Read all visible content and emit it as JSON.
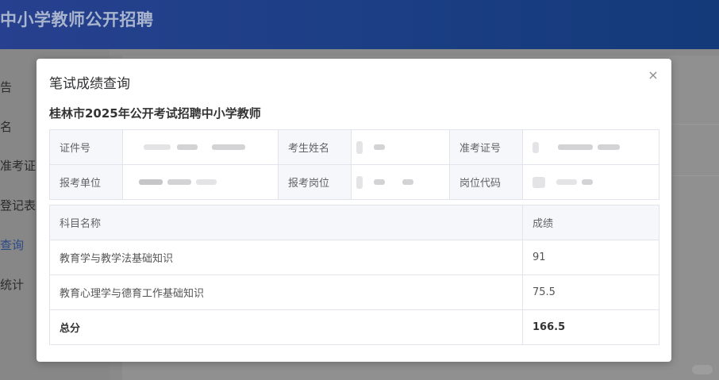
{
  "app": {
    "header_title": "中小学教师公开招聘"
  },
  "sidebar": {
    "items": [
      {
        "label": "告"
      },
      {
        "label": "名"
      },
      {
        "label": "准考证"
      },
      {
        "label": "登记表"
      },
      {
        "label": "查询"
      },
      {
        "label": "统计"
      }
    ]
  },
  "modal": {
    "title": "笔试成绩查询",
    "close_icon": "×",
    "subtitle": "桂林市2025年公开考试招聘中小学教师",
    "info_table": {
      "row1": {
        "label1": "证件号",
        "label2": "考生姓名",
        "label3": "准考证号"
      },
      "row2": {
        "label1": "报考单位",
        "label2": "报考岗位",
        "label3": "岗位代码"
      }
    },
    "score_table": {
      "header": {
        "subject": "科目名称",
        "score": "成绩"
      },
      "rows": [
        {
          "subject": "教育学与教学法基础知识",
          "score": "91"
        },
        {
          "subject": "教育心理学与德育工作基础知识",
          "score": "75.5"
        }
      ],
      "total": {
        "label": "总分",
        "score": "166.5"
      }
    }
  },
  "colors": {
    "header_gradient_start": "#27408f",
    "header_gradient_end": "#143a7a",
    "active_sidebar_text": "#2c4a88",
    "table_header_bg": "#f5f7fa",
    "table_border": "#e1e4ea"
  }
}
